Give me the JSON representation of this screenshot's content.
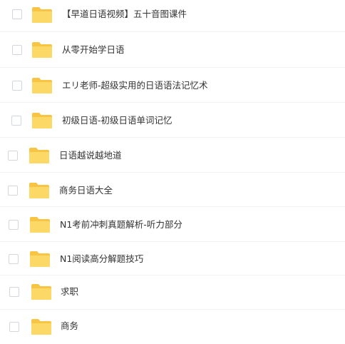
{
  "files": [
    {
      "name": "【早道日语视频】五十音图课件",
      "type": "folder"
    },
    {
      "name": "从零开始学日语",
      "type": "folder"
    },
    {
      "name": "エリ老师-超级实用的日语语法记忆术",
      "type": "folder"
    },
    {
      "name": "初级日语-初级日语单词记忆",
      "type": "folder"
    },
    {
      "name": "日语越说越地道",
      "type": "folder"
    },
    {
      "name": "商务日语大全",
      "type": "folder"
    },
    {
      "name": "N1考前冲刺真题解析-听力部分",
      "type": "folder"
    },
    {
      "name": "N1阅读高分解题技巧",
      "type": "folder"
    },
    {
      "name": "求职",
      "type": "folder"
    },
    {
      "name": "商务",
      "type": "folder"
    }
  ],
  "colors": {
    "folder_back": "#f7c443",
    "folder_front": "#fcd866",
    "text": "#333333",
    "checkbox_border": "#d3d6db",
    "divider": "#f1f2f4"
  },
  "icon": "folder-icon"
}
